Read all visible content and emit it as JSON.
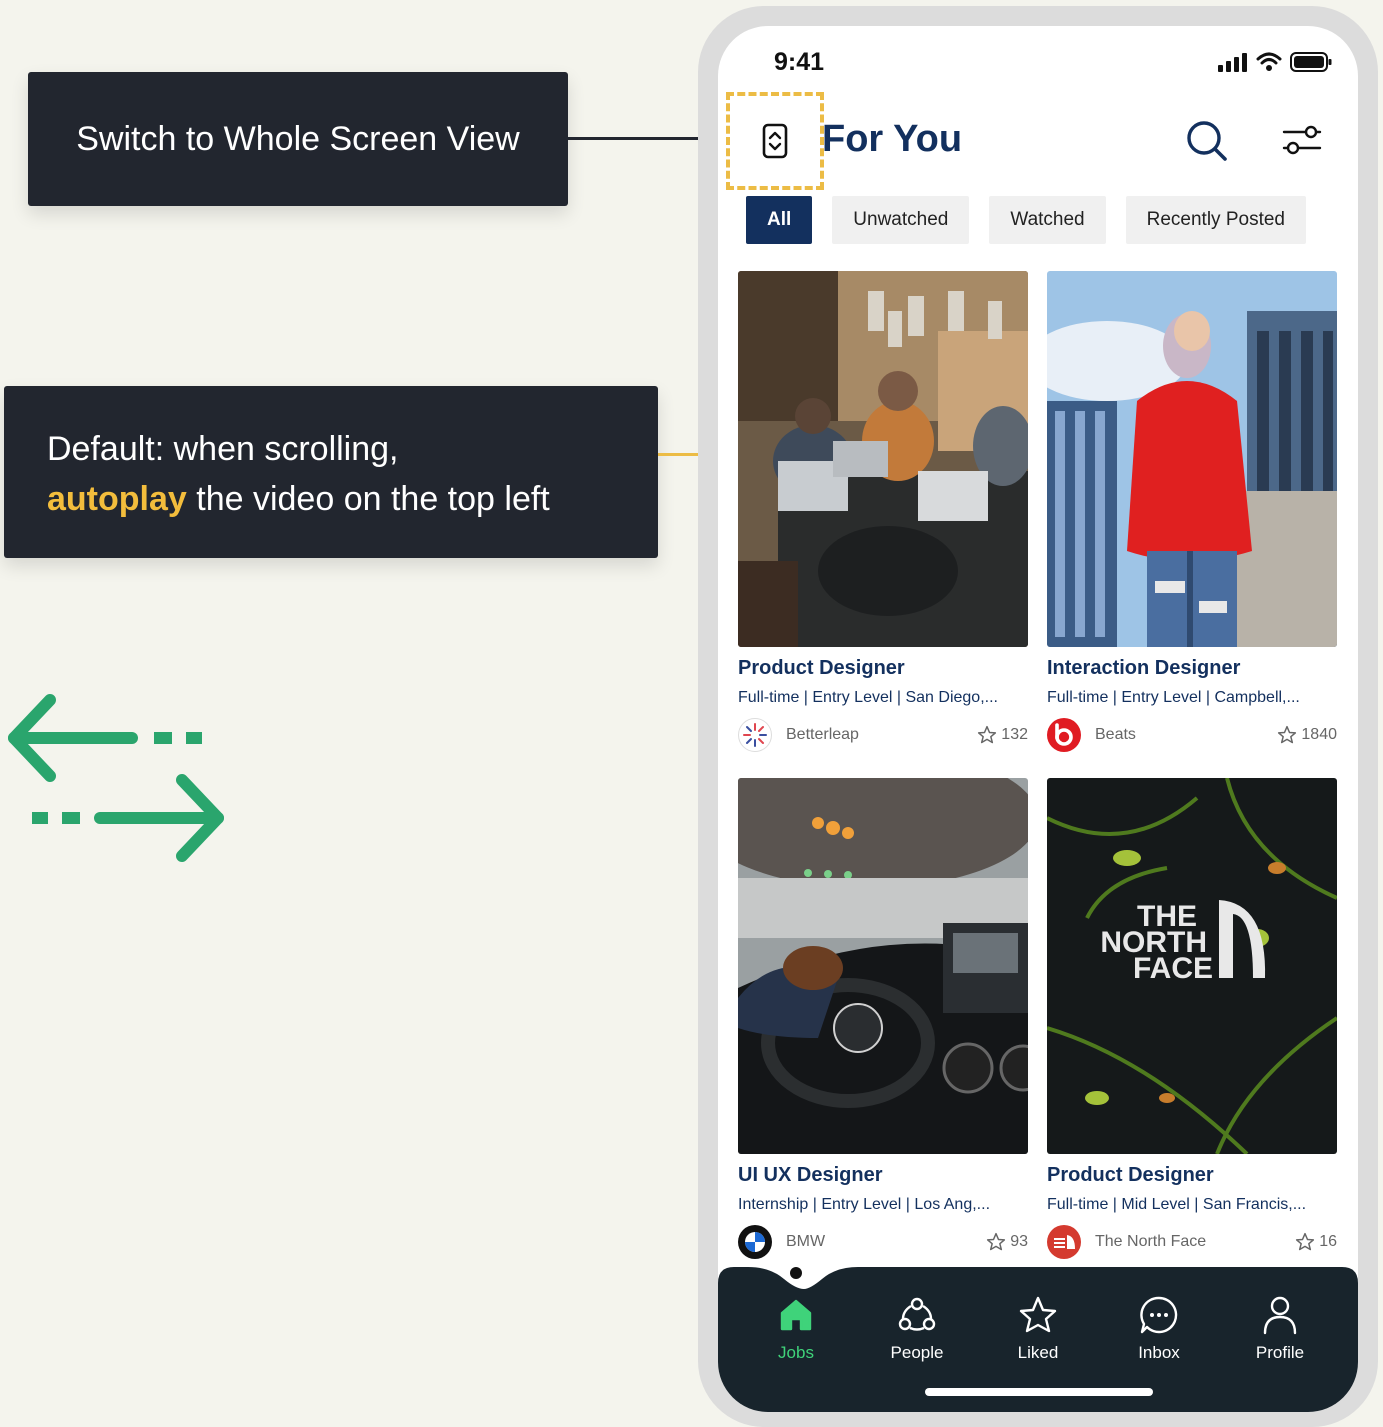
{
  "annotations": {
    "switch_view": "Switch to Whole Screen View",
    "default_prefix": "Default: when scrolling,",
    "default_highlight": "autoplay",
    "default_suffix": " the video on the top left"
  },
  "status_bar": {
    "time": "9:41"
  },
  "header": {
    "title": "For You"
  },
  "filters": [
    {
      "label": "All",
      "active": true
    },
    {
      "label": "Unwatched",
      "active": false
    },
    {
      "label": "Watched",
      "active": false
    },
    {
      "label": "Recently Posted",
      "active": false
    }
  ],
  "jobs": [
    {
      "title": "Product Designer",
      "meta": "Full-time | Entry Level | San Diego,...",
      "company": "Betterleap",
      "likes": "132"
    },
    {
      "title": "Interaction Designer",
      "meta": "Full-time | Entry Level | Campbell,...",
      "company": "Beats",
      "likes": "1840"
    },
    {
      "title": "UI UX Designer",
      "meta": "Internship | Entry Level | Los Ang,...",
      "company": "BMW",
      "likes": "93"
    },
    {
      "title": "Product Designer",
      "meta": "Full-time | Mid Level | San Francis,...",
      "company": "The North Face",
      "likes": "16"
    }
  ],
  "tabbar": [
    {
      "label": "Jobs",
      "icon": "home-icon",
      "active": true
    },
    {
      "label": "People",
      "icon": "people-icon",
      "active": false
    },
    {
      "label": "Liked",
      "icon": "star-icon",
      "active": false
    },
    {
      "label": "Inbox",
      "icon": "chat-icon",
      "active": false
    },
    {
      "label": "Profile",
      "icon": "profile-icon",
      "active": false
    }
  ],
  "colors": {
    "navy": "#13305e",
    "accent_yellow": "#ecbc45",
    "active_green": "#3fd37a",
    "tabbar_bg": "#18242c"
  }
}
